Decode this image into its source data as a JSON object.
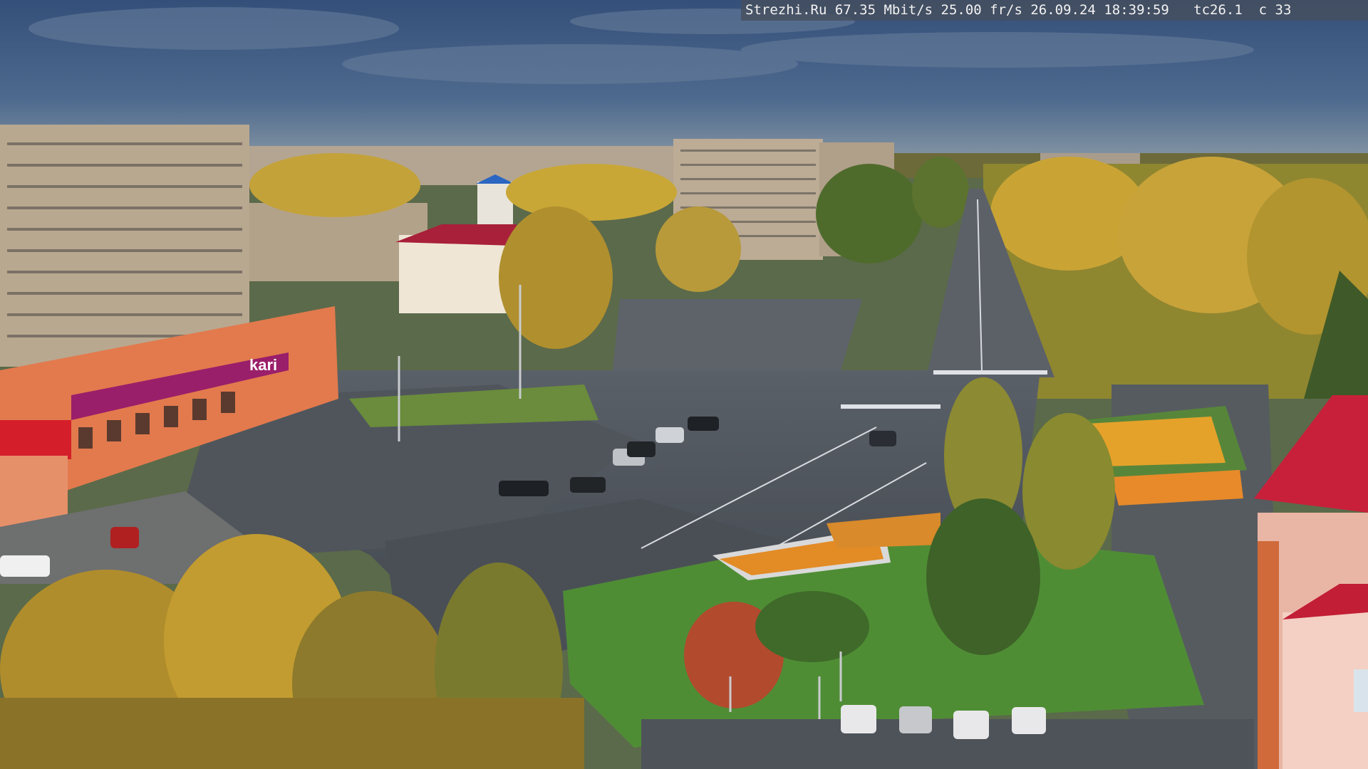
{
  "osd": {
    "text": "Strezhi.Ru 67.35 Mbit/s 25.00 fr/s 26.09.24 18:39:59   tc26.1  c 33"
  },
  "scene": {
    "sky": "#3e5a7e",
    "sky_horizon": "#8899a8",
    "road": "#4a4f56",
    "grass": "#4d8a3a",
    "tree_yellow": "#c9a52e",
    "tree_green": "#5b6e2a",
    "building_beige": "#b9a890",
    "store_orange": "#e07a4e",
    "store_magenta": "#9a1f6a",
    "roof_red": "#b22236",
    "flowers": "#e0902a"
  }
}
